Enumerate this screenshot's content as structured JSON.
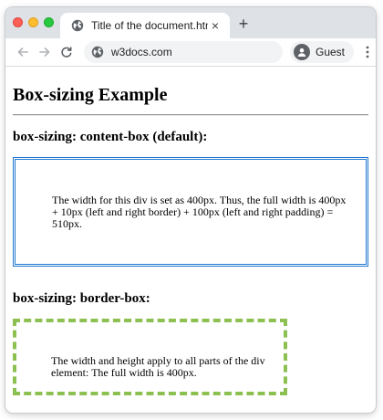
{
  "browser": {
    "tab": {
      "title": "Title of the document.html",
      "close_label": "×",
      "favicon": "globe-icon"
    },
    "new_tab_label": "+",
    "address_bar": {
      "url": "w3docs.com",
      "site_icon": "globe-icon"
    },
    "profile": {
      "label": "Guest",
      "icon": "person-icon"
    },
    "nav": {
      "back": "arrow-left-icon",
      "forward": "arrow-right-icon",
      "reload": "reload-icon",
      "menu": "kebab-menu-icon"
    },
    "traffic_lights": [
      "#ff5f57",
      "#febc2e",
      "#28c840"
    ]
  },
  "page": {
    "heading": "Box-sizing Example",
    "sections": [
      {
        "heading": "box-sizing: content-box (default):",
        "text": "The width for this div is set as 400px. Thus, the full width is 400px + 10px (left and right border) + 100px (left and right padding) = 510px.",
        "border_color": "#1f78d1",
        "border_style": "double"
      },
      {
        "heading": "box-sizing: border-box:",
        "text": "The width and height apply to all parts of the div element: The full width is 400px.",
        "border_color": "#8cc152",
        "border_style": "dashed"
      }
    ]
  }
}
